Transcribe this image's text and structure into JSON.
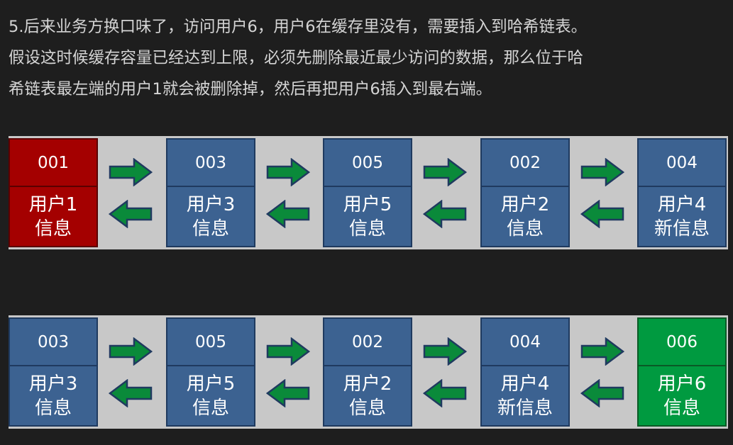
{
  "paragraph": {
    "line1": "5.后来业务方换口味了，访问用户6，用户6在缓存里没有，需要插入到哈希链表。",
    "line2": "假设这时候缓存容量已经达到上限，必须先删除最近最少访问的数据，那么位于哈",
    "line3": "希链表最左端的用户1就会被删除掉，然后再把用户6插入到最右端。"
  },
  "colors": {
    "node_default": "#3c6291",
    "node_evicted": "#a40000",
    "node_inserted": "#009a40",
    "arrow_fill": "#0a8a3a",
    "arrow_stroke": "#1f3a5f",
    "strip_background": "#c8c8c8"
  },
  "lists": [
    {
      "nodes": [
        {
          "id": "001",
          "line1": "用户1",
          "line2": "信息",
          "state": "evicted"
        },
        {
          "id": "003",
          "line1": "用户3",
          "line2": "信息",
          "state": "normal"
        },
        {
          "id": "005",
          "line1": "用户5",
          "line2": "信息",
          "state": "normal"
        },
        {
          "id": "002",
          "line1": "用户2",
          "line2": "信息",
          "state": "normal"
        },
        {
          "id": "004",
          "line1": "用户4",
          "line2": "新信息",
          "state": "normal"
        }
      ]
    },
    {
      "nodes": [
        {
          "id": "003",
          "line1": "用户3",
          "line2": "信息",
          "state": "normal"
        },
        {
          "id": "005",
          "line1": "用户5",
          "line2": "信息",
          "state": "normal"
        },
        {
          "id": "002",
          "line1": "用户2",
          "line2": "信息",
          "state": "normal"
        },
        {
          "id": "004",
          "line1": "用户4",
          "line2": "新信息",
          "state": "normal"
        },
        {
          "id": "006",
          "line1": "用户6",
          "line2": "信息",
          "state": "inserted"
        }
      ]
    }
  ],
  "icons": {
    "link_forward": "right-arrow-icon",
    "link_backward": "left-arrow-icon"
  }
}
